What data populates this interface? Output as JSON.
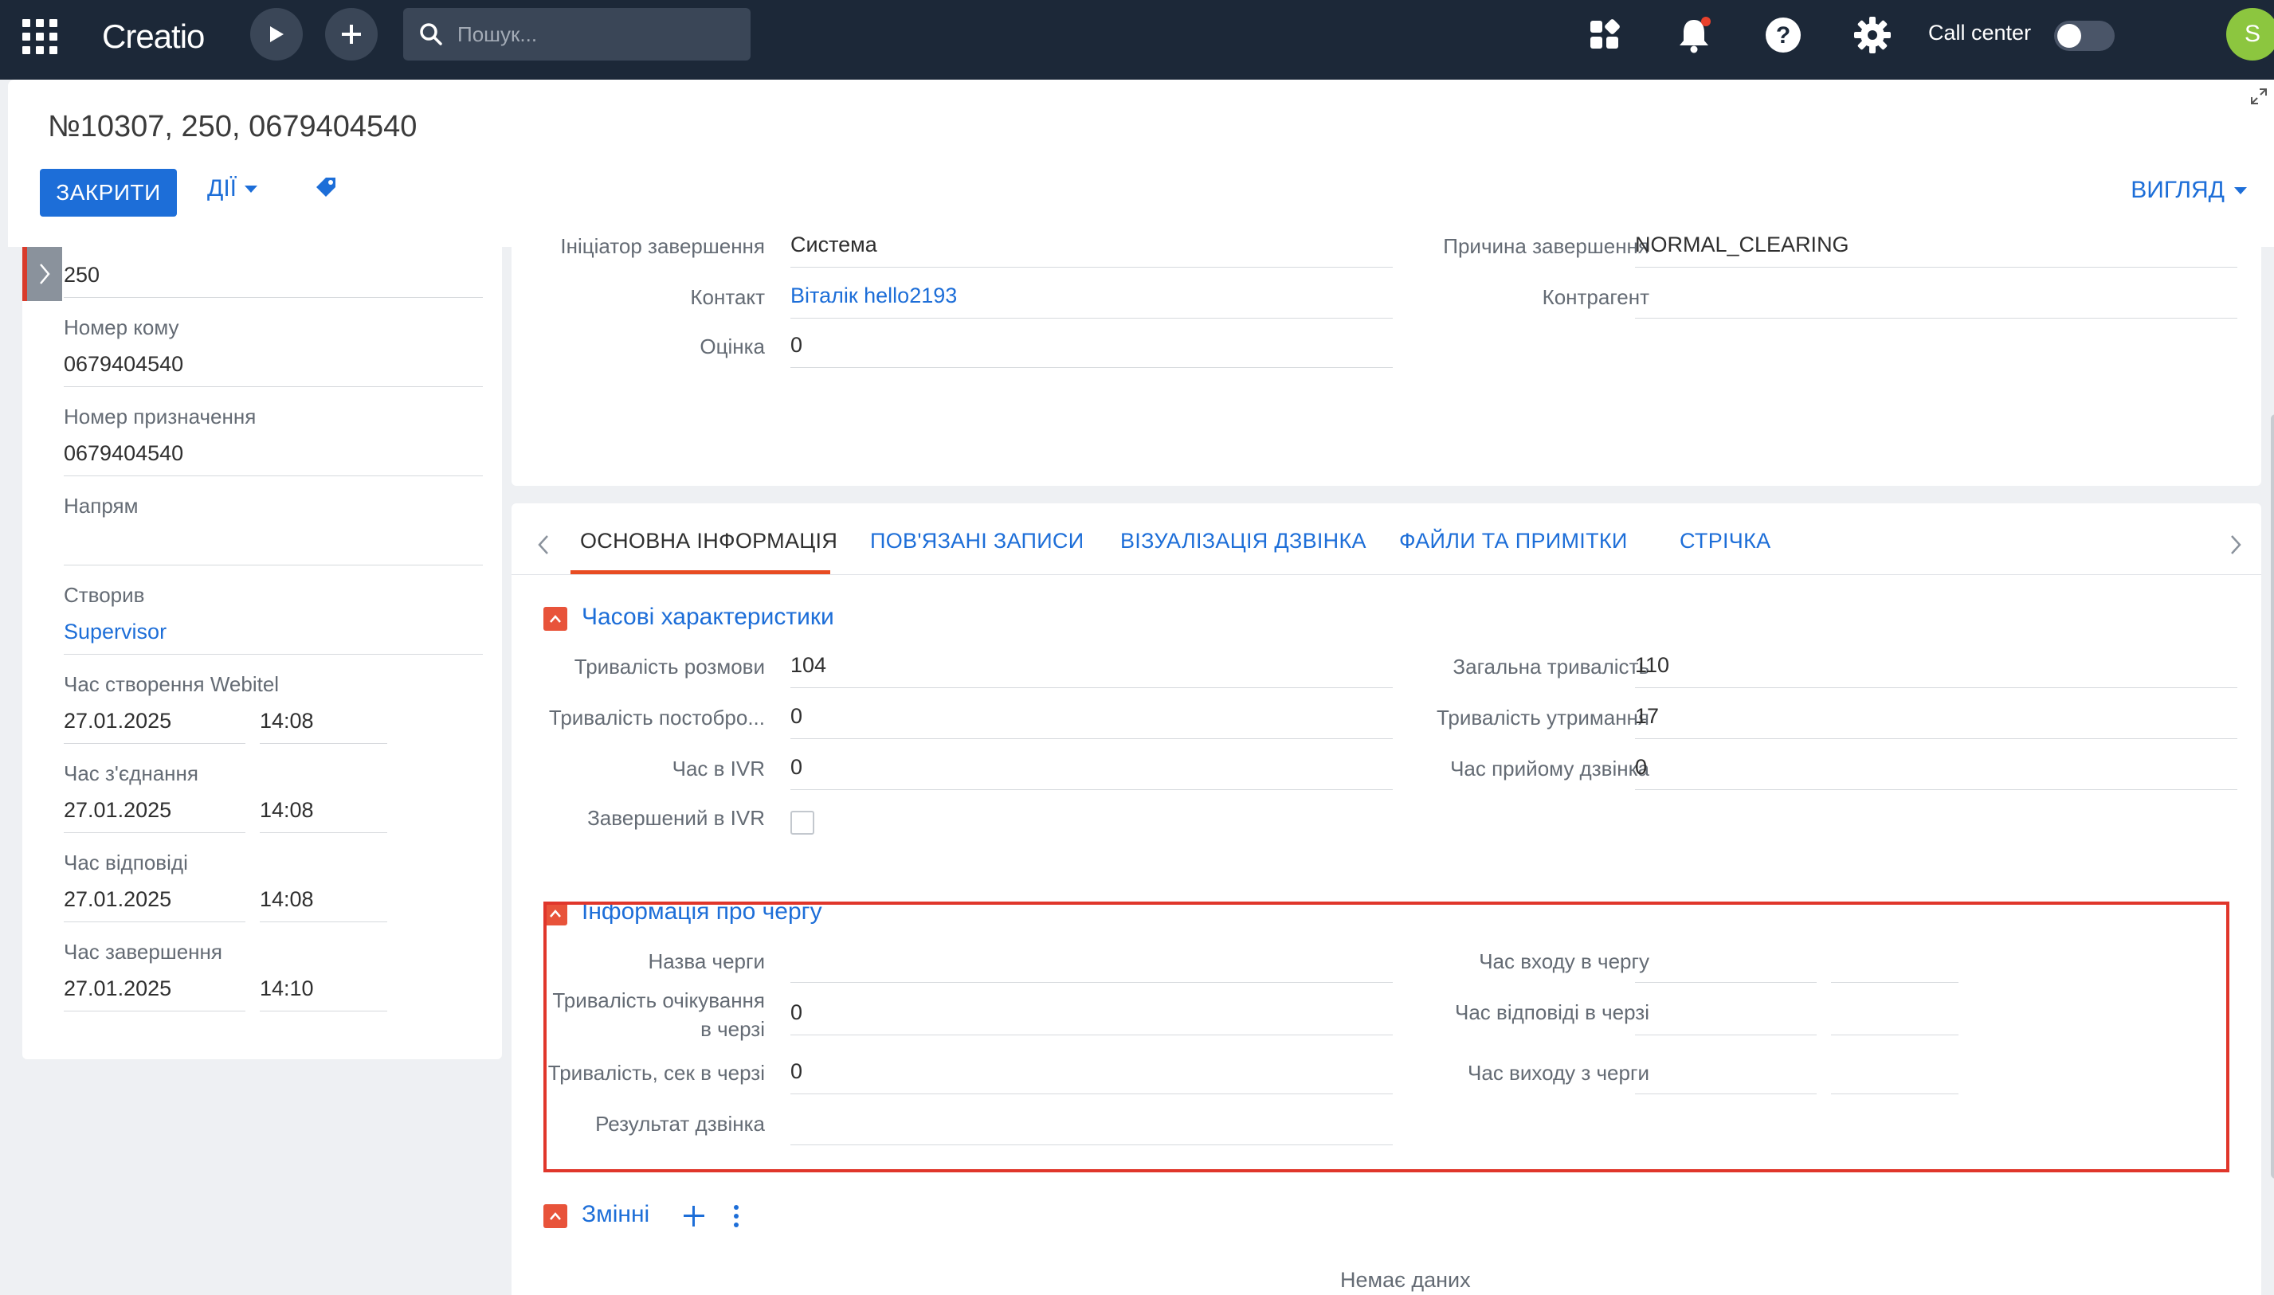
{
  "topbar": {
    "logo": "Creatio",
    "search_placeholder": "Пошук...",
    "call_center_label": "Call center",
    "avatar_letter": "S",
    "notification_dot_color": "#e8412c"
  },
  "header": {
    "title": "№10307, 250, 0679404540",
    "close_label": "ЗАКРИТИ",
    "actions_label": "ДІЇ",
    "view_label": "ВИГЛЯД"
  },
  "left": {
    "top_value": "250",
    "fields": [
      {
        "label": "Номер кому",
        "value": "0679404540"
      },
      {
        "label": "Номер призначення",
        "value": "0679404540"
      },
      {
        "label": "Напрям",
        "value": ""
      },
      {
        "label": "Створив",
        "value": "Supervisor"
      }
    ],
    "datetimes": [
      {
        "label": "Час створення Webitel",
        "date": "27.01.2025",
        "time": "14:08"
      },
      {
        "label": "Час з'єднання",
        "date": "27.01.2025",
        "time": "14:08"
      },
      {
        "label": "Час відповіді",
        "date": "27.01.2025",
        "time": "14:08"
      },
      {
        "label": "Час завершення",
        "date": "27.01.2025",
        "time": "14:10"
      }
    ]
  },
  "top_panel": {
    "initiator_label": "Ініціатор завершення",
    "initiator_value": "Система",
    "reason_label": "Причина завершення",
    "reason_value": "NORMAL_CLEARING",
    "contact_label": "Контакт",
    "contact_value": "Віталік hello2193",
    "account_label": "Контрагент",
    "account_value": "",
    "rating_label": "Оцінка",
    "rating_value": "0"
  },
  "tabs": [
    {
      "label": "ОСНОВНА ІНФОРМАЦІЯ"
    },
    {
      "label": "ПОВ'ЯЗАНІ ЗАПИСИ"
    },
    {
      "label": "ВІЗУАЛІЗАЦІЯ ДЗВІНКА"
    },
    {
      "label": "ФАЙЛИ ТА ПРИМІТКИ"
    },
    {
      "label": "СТРІЧКА"
    }
  ],
  "time_section": {
    "title": "Часові характеристики",
    "talk_duration_label": "Тривалість розмови",
    "talk_duration_value": "104",
    "total_duration_label": "Загальна тривалість",
    "total_duration_value": "110",
    "post_duration_label": "Тривалість постобро...",
    "post_duration_value": "0",
    "hold_duration_label": "Тривалість утримання",
    "hold_duration_value": "17",
    "ivr_time_label": "Час в IVR",
    "ivr_time_value": "0",
    "accept_time_label": "Час прийому дзвінка",
    "accept_time_value": "0",
    "ivr_finished_label": "Завершений в IVR"
  },
  "queue_section": {
    "title": "Інформація про чергу",
    "queue_name_label": "Назва черги",
    "queue_name_value": "",
    "wait_duration_label_1": "Тривалість очікування",
    "wait_duration_label_2": "в черзі",
    "wait_duration_value": "0",
    "sec_in_queue_label": "Тривалість, сек в черзі",
    "sec_in_queue_value": "0",
    "result_label": "Результат дзвінка",
    "result_value": "",
    "enter_time_label": "Час входу в чергу",
    "answer_time_label": "Час відповіді в черзі",
    "exit_time_label": "Час виходу з черги"
  },
  "vars_section": {
    "title": "Змінні",
    "empty_text": "Немає даних"
  },
  "colors": {
    "topbar": "#1c2838",
    "primary": "#1d6ed8",
    "accent": "#e8533a",
    "highlight": "#e0362b"
  }
}
